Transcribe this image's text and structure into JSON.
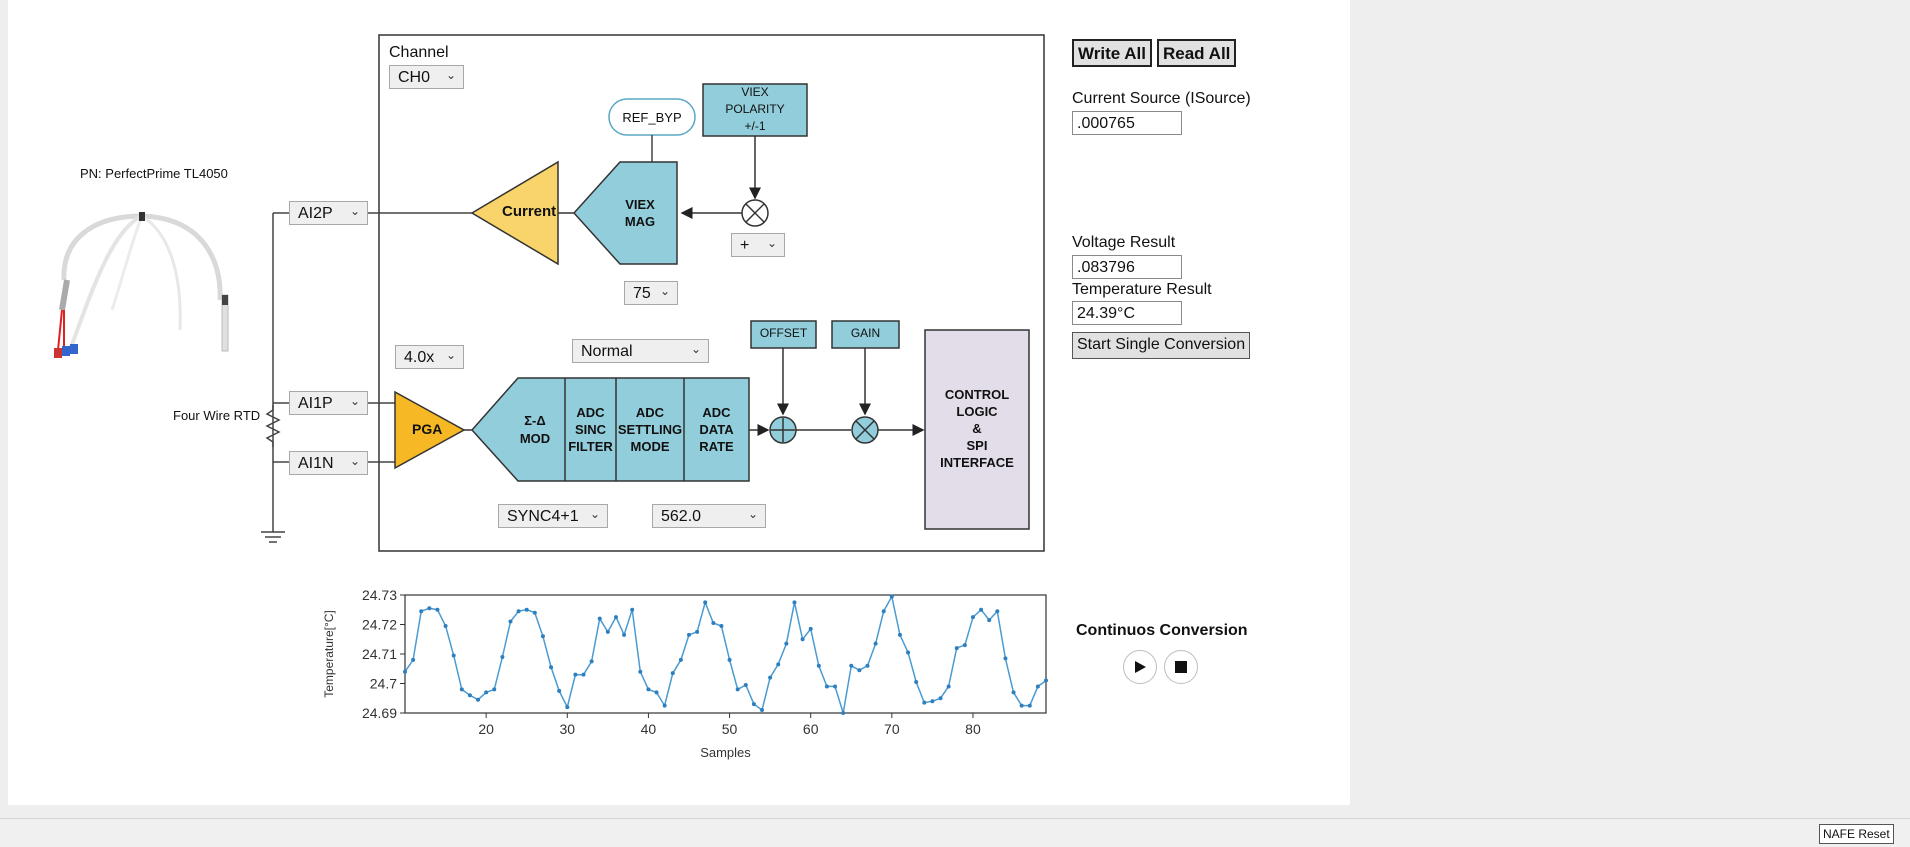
{
  "channel": {
    "label": "Channel",
    "value": "CH0"
  },
  "sensor": {
    "part_number": "PN: PerfectPrime TL4050",
    "wiring_label": "Four Wire RTD"
  },
  "inputs": {
    "ai2p": "AI2P",
    "ai1p": "AI1P",
    "ai1n": "AI1N"
  },
  "blocks": {
    "ref_byp": "REF_BYP",
    "viex_polarity": [
      "VIEX",
      "POLARITY",
      "+/-1"
    ],
    "current": "Current",
    "viex_mag": [
      "VIEX",
      "MAG"
    ],
    "pga": "PGA",
    "sd_mod": [
      "Σ-Δ",
      "MOD"
    ],
    "adc_sinc": [
      "ADC",
      "SINC",
      "FILTER"
    ],
    "adc_settling": [
      "ADC",
      "SETTLING",
      "MODE"
    ],
    "adc_rate": [
      "ADC",
      "DATA",
      "RATE"
    ],
    "offset": "OFFSET",
    "gain": "GAIN",
    "control": [
      "CONTROL",
      "LOGIC",
      "&",
      "SPI",
      "INTERFACE"
    ]
  },
  "dropdowns": {
    "polarity": "+",
    "viex_mag_value": "75",
    "pga_gain": "4.0x",
    "settling_mode": "Normal",
    "sinc_filter": "SYNC4+1",
    "data_rate": "562.0"
  },
  "side": {
    "write_all": "Write All",
    "read_all": "Read All",
    "isource_label": "Current Source (ISource)",
    "isource_value": ".000765",
    "voltage_label": "Voltage Result",
    "voltage_value": ".083796",
    "temperature_label": "Temperature Result",
    "temperature_value": "24.39°C",
    "start_button": "Start Single Conversion",
    "continuous_label": "Continuos Conversion",
    "play_icon": "play-icon",
    "stop_icon": "stop-icon"
  },
  "footer": {
    "reset_button": "NAFE Reset"
  },
  "colors": {
    "block_blue": "#92cddb",
    "current_yellow": "#f8d46a",
    "pga_orange": "#f7b825",
    "control_purple": "#e3dde9",
    "line_blue": "#4a9bd1"
  },
  "chart_data": {
    "type": "line",
    "xlabel": "Samples",
    "ylabel": "Temperature[°C]",
    "xlim": [
      10,
      89
    ],
    "ylim": [
      24.69,
      24.73
    ],
    "xticks": [
      20,
      30,
      40,
      50,
      60,
      70,
      80
    ],
    "yticks": [
      24.69,
      24.7,
      24.71,
      24.72,
      24.73
    ],
    "ytick_labels": [
      "24.69",
      "24.7",
      "24.71",
      "24.72",
      "24.73"
    ],
    "grid": false,
    "series": [
      {
        "x": [
          10,
          11,
          12,
          13,
          14,
          15,
          16,
          17,
          18,
          19,
          20,
          21,
          22,
          23,
          24,
          25,
          26,
          27,
          28,
          29,
          30,
          31,
          32,
          33,
          34,
          35,
          36,
          37,
          38,
          39,
          40,
          41,
          42,
          43,
          44,
          45,
          46,
          47,
          48,
          49,
          50,
          51,
          52,
          53,
          54,
          55,
          56,
          57,
          58,
          59,
          60,
          61,
          62,
          63,
          64,
          65,
          66,
          67,
          68,
          69,
          70,
          71,
          72,
          73,
          74,
          75,
          76,
          77,
          78,
          79,
          80,
          81,
          82,
          83,
          84,
          85,
          86,
          87,
          88,
          89
        ],
        "y": [
          24.704,
          24.708,
          24.7245,
          24.7255,
          24.725,
          24.7195,
          24.7095,
          24.698,
          24.696,
          24.6945,
          24.697,
          24.698,
          24.709,
          24.721,
          24.7245,
          24.725,
          24.724,
          24.716,
          24.7055,
          24.6975,
          24.692,
          24.703,
          24.703,
          24.7075,
          24.722,
          24.7175,
          24.7225,
          24.7165,
          24.725,
          24.704,
          24.698,
          24.697,
          24.6925,
          24.7035,
          24.708,
          24.7165,
          24.7175,
          24.7275,
          24.7205,
          24.7195,
          24.708,
          24.698,
          24.6995,
          24.693,
          24.691,
          24.702,
          24.7065,
          24.7135,
          24.7275,
          24.715,
          24.7185,
          24.706,
          24.699,
          24.699,
          24.69,
          24.706,
          24.7045,
          24.706,
          24.7135,
          24.7245,
          24.7295,
          24.7165,
          24.7105,
          24.7005,
          24.6935,
          24.694,
          24.695,
          24.699,
          24.712,
          24.713,
          24.7225,
          24.725,
          24.7215,
          24.7245,
          24.7085,
          24.697,
          24.6925,
          24.6925,
          24.699,
          24.701
        ]
      }
    ]
  }
}
